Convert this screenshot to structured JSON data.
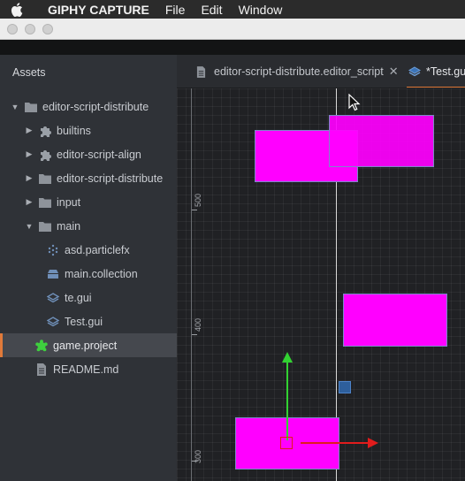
{
  "menubar": {
    "app_name": "GIPHY CAPTURE",
    "items": [
      "File",
      "Edit",
      "Window"
    ]
  },
  "sidebar": {
    "title": "Assets",
    "tree": [
      {
        "label": "editor-script-distribute",
        "depth": 0,
        "expanded": true,
        "icon": "folder-icon"
      },
      {
        "label": "builtins",
        "depth": 1,
        "expanded": false,
        "icon": "puzzle-icon"
      },
      {
        "label": "editor-script-align",
        "depth": 1,
        "expanded": false,
        "icon": "puzzle-icon"
      },
      {
        "label": "editor-script-distribute",
        "depth": 1,
        "expanded": false,
        "icon": "folder-icon"
      },
      {
        "label": "input",
        "depth": 1,
        "expanded": false,
        "icon": "folder-icon"
      },
      {
        "label": "main",
        "depth": 1,
        "expanded": true,
        "icon": "folder-icon"
      },
      {
        "label": "asd.particlefx",
        "depth": 2,
        "icon": "particlefx-icon"
      },
      {
        "label": "main.collection",
        "depth": 2,
        "icon": "collection-icon"
      },
      {
        "label": "te.gui",
        "depth": 2,
        "icon": "gui-icon"
      },
      {
        "label": "Test.gui",
        "depth": 2,
        "icon": "gui-icon"
      },
      {
        "label": "game.project",
        "depth": 1,
        "icon": "project-icon",
        "selected": true
      },
      {
        "label": "README.md",
        "depth": 1,
        "icon": "file-icon"
      }
    ]
  },
  "tabs": [
    {
      "label": "editor-script-distribute.editor_script",
      "icon": "file-icon",
      "closable": true,
      "active": false
    },
    {
      "label": "*Test.gui",
      "icon": "gui-icon",
      "closable": false,
      "active": true
    }
  ],
  "ruler": {
    "labels": [
      "500",
      "400",
      "300"
    ]
  },
  "colors": {
    "accent": "#e07a3a",
    "box_fill": "#ff00ff",
    "gizmo_y": "#32d232",
    "gizmo_x": "#e11c1c"
  }
}
